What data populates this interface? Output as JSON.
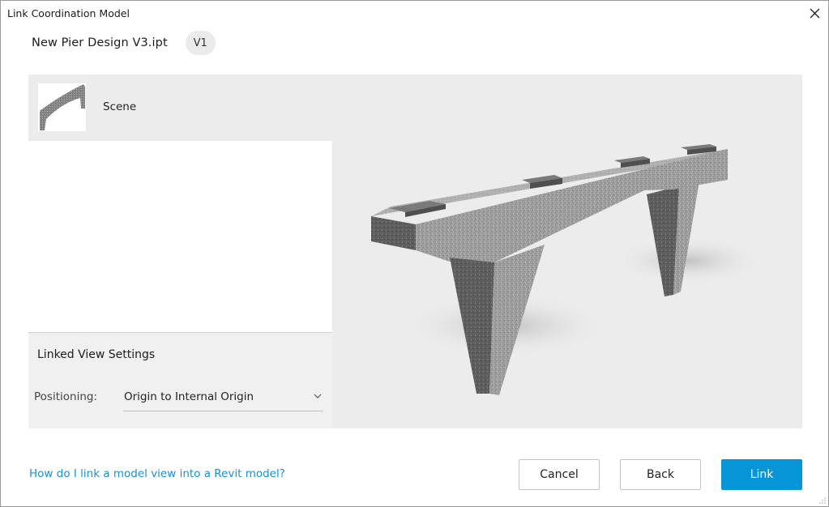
{
  "window": {
    "title": "Link Coordination Model"
  },
  "file": {
    "name": "New Pier Design V3.ipt",
    "version": "V1"
  },
  "views": {
    "items": [
      {
        "label": "Scene",
        "selected": true
      }
    ]
  },
  "settings": {
    "title": "Linked View Settings",
    "positioning_label": "Positioning:",
    "positioning_value": "Origin to Internal Origin"
  },
  "footer": {
    "help_link": "How do I link a model view into a Revit model?",
    "cancel_label": "Cancel",
    "back_label": "Back",
    "link_label": "Link"
  },
  "colors": {
    "accent": "#0696d7",
    "link_text": "#1b8fd6",
    "panel_bg": "#ececec"
  },
  "icons": {
    "close": "close-icon",
    "dropdown": "chevron-down-icon"
  }
}
